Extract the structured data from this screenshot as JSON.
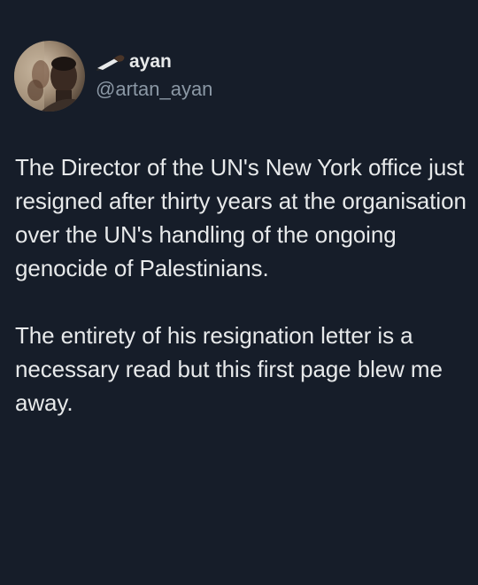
{
  "author": {
    "display_name": "ayan",
    "display_name_emoji": "writing-hand-emoji",
    "handle": "@artan_ayan",
    "avatar": "profile-photo"
  },
  "tweet": {
    "paragraphs": [
      "The Director of the UN's New York office just resigned after thirty years at the organisation over the UN's handling of the ongoing genocide of Palestinians.",
      "The entirety of his resignation letter is a necessary read but this first page blew me away."
    ]
  },
  "colors": {
    "background": "#161d29",
    "text_primary": "#e7e9ea",
    "text_secondary": "#8b98a5"
  }
}
